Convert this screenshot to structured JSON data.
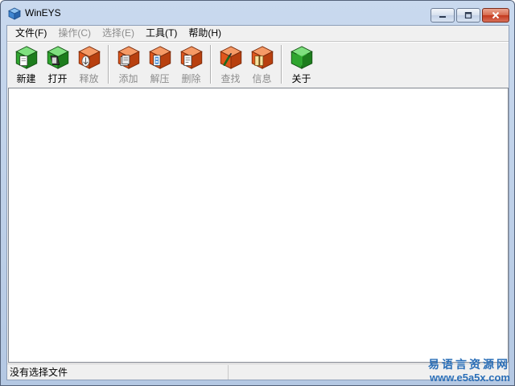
{
  "window": {
    "title": "WinEYS",
    "app_icon": "blue-cube-icon"
  },
  "caption_buttons": [
    {
      "name": "minimize-icon"
    },
    {
      "name": "maximize-icon"
    },
    {
      "name": "close-icon"
    }
  ],
  "menu": {
    "items": [
      {
        "label": "文件(F)",
        "enabled": true
      },
      {
        "label": "操作(C)",
        "enabled": false
      },
      {
        "label": "选择(E)",
        "enabled": false
      },
      {
        "label": "工具(T)",
        "enabled": true
      },
      {
        "label": "帮助(H)",
        "enabled": true
      }
    ]
  },
  "toolbar": {
    "groups": [
      [
        {
          "label": "新建",
          "icon": "new-archive-icon",
          "enabled": true
        },
        {
          "label": "打开",
          "icon": "open-archive-icon",
          "enabled": true
        },
        {
          "label": "释放",
          "icon": "extract-icon",
          "enabled": false
        }
      ],
      [
        {
          "label": "添加",
          "icon": "add-files-icon",
          "enabled": false
        },
        {
          "label": "解压",
          "icon": "decompress-icon",
          "enabled": false
        },
        {
          "label": "删除",
          "icon": "delete-icon",
          "enabled": false
        }
      ],
      [
        {
          "label": "查找",
          "icon": "find-icon",
          "enabled": false
        },
        {
          "label": "信息",
          "icon": "info-icon",
          "enabled": false
        }
      ],
      [
        {
          "label": "关于",
          "icon": "about-icon",
          "enabled": true
        }
      ]
    ]
  },
  "status": {
    "text": "没有选择文件"
  },
  "watermark": {
    "title": "易语言资源网",
    "url": "www.e5a5x.com"
  },
  "colors": {
    "enabled_cube": "#2fa52f",
    "disabled_cube": "#e0561c",
    "watermark": "#2b6fb8"
  }
}
